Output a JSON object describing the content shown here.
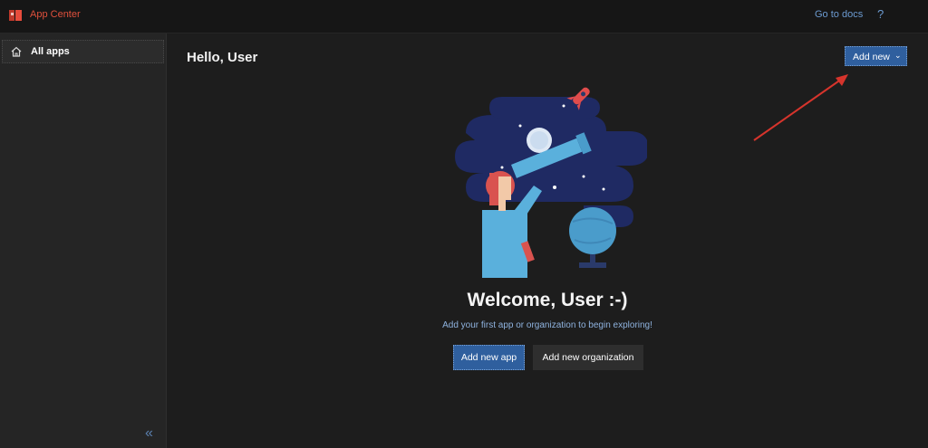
{
  "header": {
    "app_title": "App Center",
    "docs_link": "Go to docs",
    "help_glyph": "?",
    "logo_icon": "app-center-logo-icon"
  },
  "sidebar": {
    "items": [
      {
        "label": "All apps",
        "icon": "home-icon",
        "selected": true
      }
    ],
    "collapse_glyph": "«"
  },
  "main": {
    "title": "Hello, User",
    "add_new_button": {
      "label": "Add new",
      "chevron": "⌄"
    },
    "welcome": "Welcome, User :-)",
    "subtitle": "Add your first app or organization to begin exploring!",
    "actions": {
      "add_app": "Add new app",
      "add_org": "Add new organization"
    }
  },
  "colors": {
    "accent": "#2f5f9e",
    "brand": "#e0503c",
    "link": "#6c9bd1",
    "annotation_arrow": "#d6342c"
  }
}
